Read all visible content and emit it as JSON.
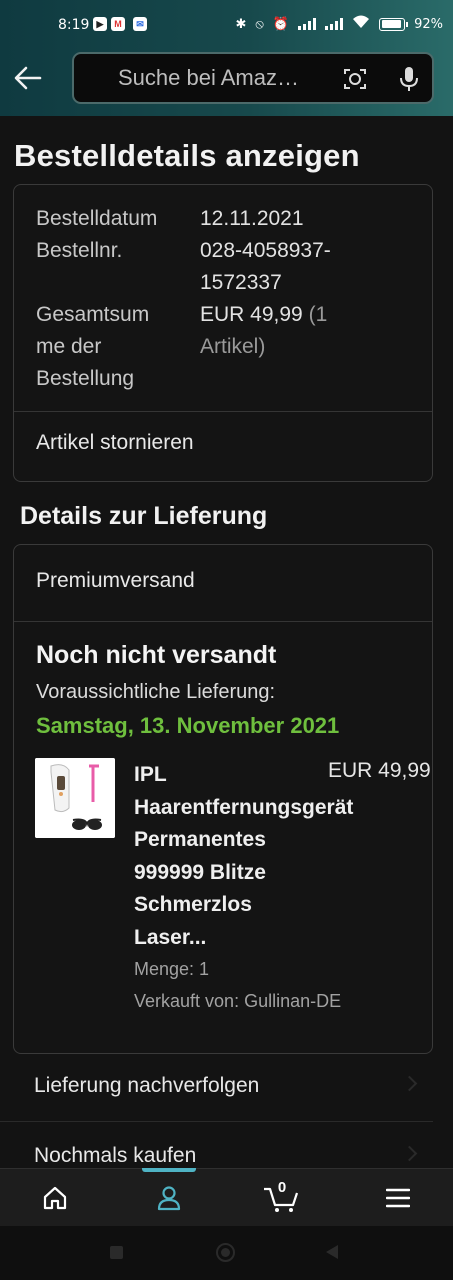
{
  "status_bar": {
    "time": "8:19",
    "battery": "92%",
    "battery_level": 0.92,
    "notification_icons": [
      "play-icon",
      "gmail-icon",
      "messenger-icon"
    ],
    "system_icons": [
      "bluetooth-icon",
      "vibrate-off-icon",
      "alarm-icon",
      "signal-icon",
      "signal-icon",
      "wifi-icon",
      "battery-icon"
    ]
  },
  "header": {
    "search_placeholder": "Suche bei Amaz…",
    "icons": [
      "back-arrow-icon",
      "camera-icon",
      "mic-icon"
    ]
  },
  "page": {
    "title": "Bestelldetails anzeigen"
  },
  "order_summary": {
    "order_date_label": "Bestelldatum",
    "order_date": "12.11.2021",
    "order_number_label": "Bestellnr.",
    "order_number_line1": "028-4058937-",
    "order_number_line2": "1572337",
    "total_label_line1": "Gesamtsum",
    "total_label_line2": "me der",
    "total_label_line3": "Bestellung",
    "total_value": "EUR 49,99",
    "total_items_line1": "(1",
    "total_items_line2": "Artikel)",
    "cancel_label": "Artikel stornieren"
  },
  "delivery": {
    "section_title": "Details zur Lieferung",
    "shipping_method": "Premiumversand",
    "status": "Noch nicht versandt",
    "eta_label": "Voraussichtliche Lieferung:",
    "eta_date": "Samstag, 13. November 2021",
    "product": {
      "title_lines": [
        "IPL",
        "Haarentfernungsgerät",
        "Permanentes",
        "999999 Blitze",
        "Schmerzlos",
        "Laser..."
      ],
      "price": "EUR 49,99",
      "quantity": "Menge: 1",
      "seller": "Verkauft von: Gullinan-DE"
    }
  },
  "actions": {
    "track": "Lieferung nachverfolgen",
    "buy_again": "Nochmals kaufen"
  },
  "bottom_nav": {
    "items": [
      "home-icon",
      "account-icon",
      "cart-icon",
      "menu-icon"
    ],
    "active": "account-icon",
    "cart_count": "0"
  },
  "colors": {
    "header_gradient_start": "#0f3a40",
    "header_gradient_end": "#2a6b69",
    "background": "#131313",
    "eta_green": "#6fbf3e",
    "active_tab": "#4fb3c4"
  }
}
